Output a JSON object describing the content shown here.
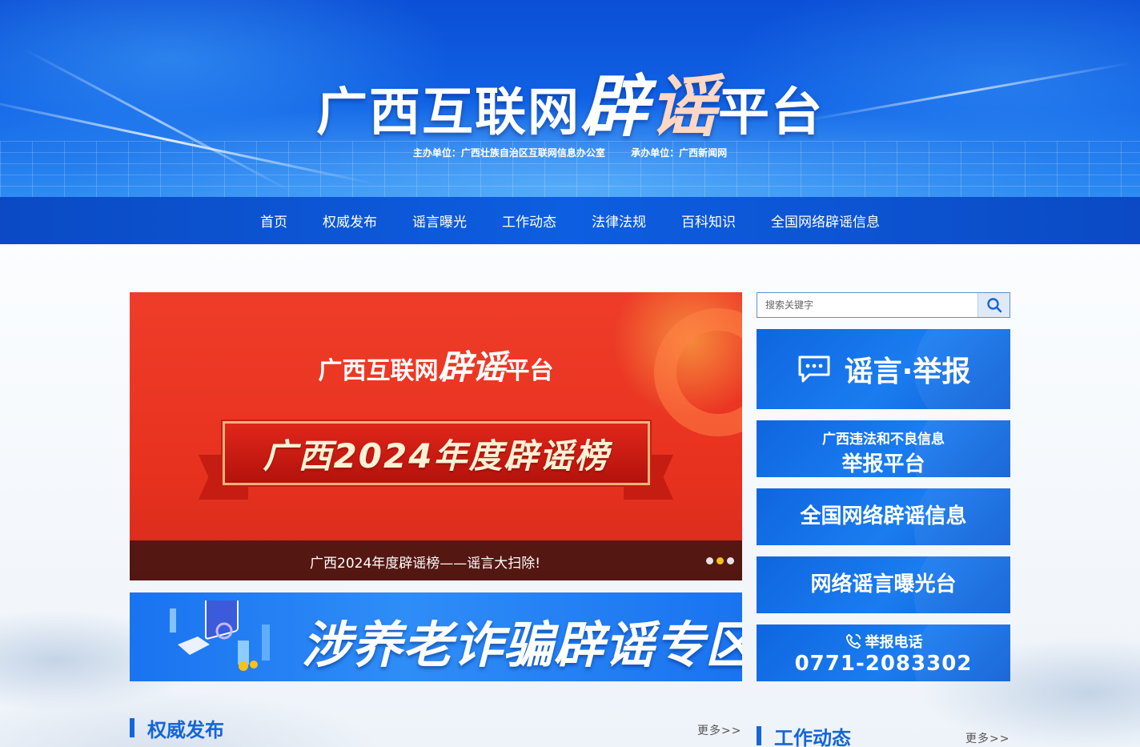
{
  "header": {
    "title_part1": "广西互联网",
    "title_part2": "辟",
    "title_part3": "谣",
    "title_part4": "平台",
    "sponsor": "主办单位：广西壮族自治区互联网信息办公室",
    "organizer": "承办单位：广西新闻网"
  },
  "nav": {
    "items": [
      "首页",
      "权威发布",
      "谣言曝光",
      "工作动态",
      "法律法规",
      "百科知识",
      "全国网络辟谣信息"
    ]
  },
  "carousel": {
    "logo_part1": "广西互联网",
    "logo_part2": "辟谣",
    "logo_part3": "平台",
    "headline": "广西2024年度辟谣榜",
    "caption": "广西2024年度辟谣榜——谣言大扫除!",
    "dots_total": 3,
    "dots_active_index": 1
  },
  "banner": {
    "text": "涉养老诈骗辟谣专区"
  },
  "search": {
    "placeholder": "搜索关键字"
  },
  "sidebar": {
    "report_label": "谣言·举报",
    "illegal_line1": "广西违法和不良信息",
    "illegal_line2": "举报平台",
    "national_label": "全国网络辟谣信息",
    "exposure_label": "网络谣言曝光台",
    "hotline_label": "举报电话",
    "hotline_number": "0771-2083302"
  },
  "sections": {
    "left_title": "权威发布",
    "left_more": "更多>>",
    "right_title": "工作动态",
    "right_more": "更多>>"
  },
  "colors": {
    "brand_blue": "#1565d8",
    "nav_blue": "#0d5ee0",
    "carousel_red": "#e8321f",
    "dot_active": "#f5c21b"
  }
}
